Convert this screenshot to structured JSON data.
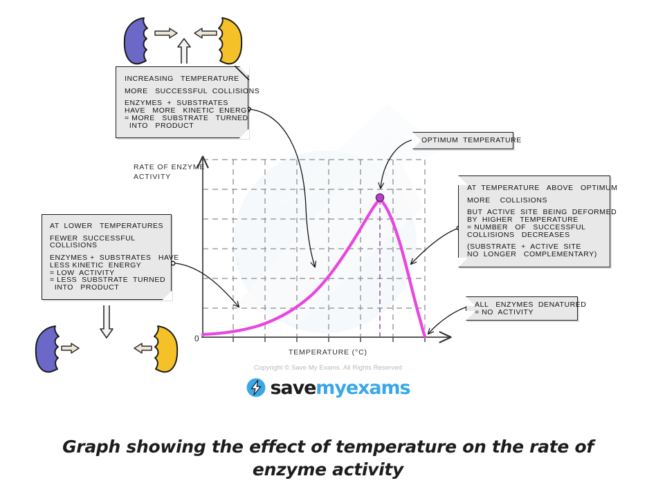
{
  "figure": {
    "caption": "Graph showing the effect of temperature on the rate of enzyme activity",
    "copyright": "Copyright © Save My Exams. All Rights Reserved",
    "logo": {
      "part1": "save",
      "part2": "my",
      "part3": "exams",
      "icon": "lightning-bolt-icon"
    }
  },
  "axes": {
    "y_label": "RATE OF ENZYME\nACTIVITY",
    "x_label": "TEMPERATURE (°C)",
    "origin_label": "0"
  },
  "callouts": {
    "increasing_temperature": {
      "title": "INCREASING   TEMPERATURE",
      "line2": "MORE   SUCCESSFUL  COLLISIONS",
      "line3": "ENZYMES  +  SUBSTRATES",
      "line4": "HAVE   MORE   KINETIC  ENERGY",
      "line5": "= MORE   SUBSTRATE   TURNED",
      "line6": "  INTO   PRODUCT"
    },
    "lower_temperatures": {
      "title": "AT  LOWER   TEMPERATURES",
      "line2": "FEWER  SUCCESSFUL",
      "line3": "COLLISIONS",
      "line4": "ENZYMES +  SUBSTRATES   HAVE",
      "line5": "LESS KINETIC  ENERGY",
      "line6": "= LOW  ACTIVITY",
      "line7": "= LESS  SUBSTRATE  TURNED",
      "line8": "  INTO   PRODUCT"
    },
    "optimum_temperature": {
      "title": "OPTIMUM  TEMPERATURE"
    },
    "above_optimum": {
      "title": "AT  TEMPERATURE   ABOVE   OPTIMUM",
      "line2": "MORE    COLLISIONS",
      "line3": "BUT  ACTIVE  SITE  BEING  DEFORMED",
      "line4": "BY  HIGHER   TEMPERATURE",
      "line5": "= NUMBER   OF   SUCCESSFUL",
      "line6": "COLLISIONS   DECREASES",
      "line7": "(SUBSTRATE  +  ACTIVE  SITE",
      "line8": "NO  LONGER   COMPLEMENTARY)"
    },
    "denatured": {
      "title": "ALL   ENZYMES  DENATURED",
      "line2": "= NO  ACTIVITY"
    }
  },
  "colors": {
    "curve": "#e846e0",
    "optimum_point": "#b83fc4",
    "enzyme": "#6b68c8",
    "substrate": "#f5c128",
    "grid": "#8a8a8a",
    "box_fill": "#e8e8e8",
    "logo_blue": "#3aa7e8"
  },
  "chart_data": {
    "type": "line",
    "title": "Graph showing the effect of temperature on the rate of enzyme activity",
    "xlabel": "TEMPERATURE (°C)",
    "ylabel": "RATE OF ENZYME ACTIVITY",
    "grid": true,
    "legend": "none",
    "xlim": [
      0,
      100
    ],
    "ylim": [
      0,
      100
    ],
    "annotations": [
      {
        "label": "OPTIMUM  TEMPERATURE",
        "x": 80,
        "y": 80,
        "marker": "filled-circle"
      },
      {
        "label": "ALL   ENZYMES  DENATURED = NO  ACTIVITY",
        "x": 100,
        "y": 0
      }
    ],
    "series": [
      {
        "name": "rate of enzyme activity",
        "x": [
          0,
          5,
          10,
          15,
          20,
          25,
          30,
          35,
          40,
          45,
          50,
          55,
          60,
          65,
          70,
          75,
          80,
          82,
          85,
          88,
          92,
          96,
          100
        ],
        "y": [
          1,
          1.5,
          2.5,
          4,
          6,
          8.5,
          11,
          15,
          20,
          26,
          34,
          43,
          53,
          63,
          72,
          78,
          80,
          79,
          73,
          62,
          42,
          20,
          0
        ]
      }
    ]
  }
}
